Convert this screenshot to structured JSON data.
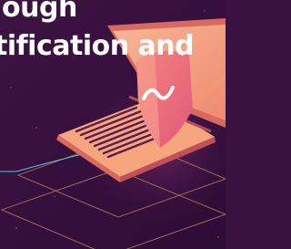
{
  "headline": {
    "line1": "ough",
    "line2": "tification and"
  },
  "colors": {
    "background": "#3a1240",
    "laptop_lid": "#f08a6a",
    "laptop_screen": "#f6b190",
    "laptop_base": "#f7a57c",
    "laptop_side": "#d9685e",
    "keyboard": "#5a1e4f",
    "shield": "#f2757c",
    "shield_highlight": "#fbc4b0",
    "outline": "#d8a46a",
    "accent_line": "#4fc6d9"
  },
  "icons": {
    "shield": "shield-icon",
    "check": "check-swoosh-icon"
  }
}
